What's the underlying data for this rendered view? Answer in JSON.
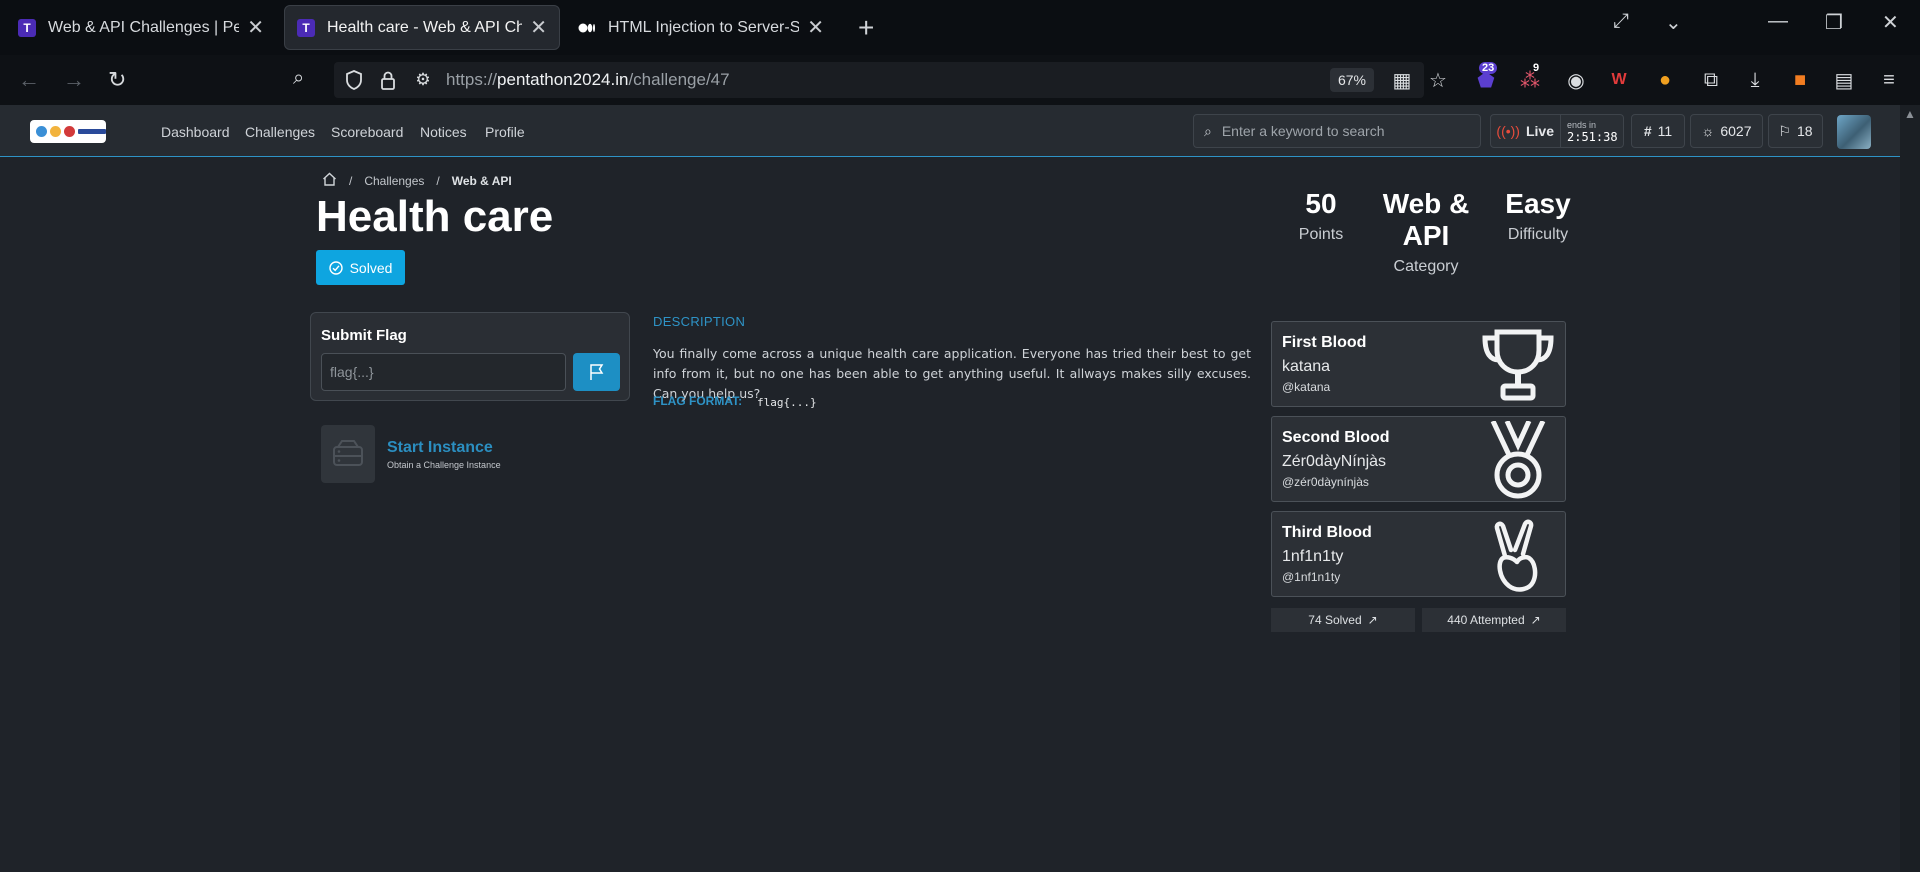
{
  "browser": {
    "tabs": [
      {
        "title": "Web & API Challenges | Pentathon",
        "active": false
      },
      {
        "title": "Health care - Web & API Challenges",
        "active": true
      },
      {
        "title": "HTML Injection to Server-Side Request Forgery",
        "active": false
      }
    ],
    "url_prefix": "https://",
    "url_host": "pentathon2024.in",
    "url_path": "/challenge/47",
    "zoom": "67%",
    "badges": {
      "ext1": "23",
      "ext2": "9"
    }
  },
  "header": {
    "menu": [
      "Dashboard",
      "Challenges",
      "Scoreboard",
      "Notices",
      "Profile"
    ],
    "search_placeholder": "Enter a keyword to search",
    "live_label": "Live",
    "ends_label": "ends in",
    "countdown": "2:51:38",
    "rank": "11",
    "score": "6027",
    "flags": "18"
  },
  "breadcrumb": {
    "level1": "Challenges",
    "level2": "Web & API"
  },
  "challenge": {
    "title": "Health care",
    "status": "Solved",
    "points_value": "50",
    "points_label": "Points",
    "category_value": "Web & API",
    "category_label": "Category",
    "difficulty_value": "Easy",
    "difficulty_label": "Difficulty",
    "description_heading": "DESCRIPTION",
    "description": "You finally come across a unique health care application. Everyone has tried their best to get info from it, but no one has been able to get anything useful. It allways makes silly excuses. Can you help us?",
    "flag_format_label": "FLAG FORMAT:",
    "flag_format": "flag{...}"
  },
  "submit": {
    "heading": "Submit Flag",
    "placeholder": "flag{...}"
  },
  "instance": {
    "title": "Start Instance",
    "subtitle": "Obtain a Challenge Instance"
  },
  "bloods": [
    {
      "title": "First Blood",
      "name": "katana",
      "handle": "@katana",
      "icon": "trophy-icon"
    },
    {
      "title": "Second Blood",
      "name": "Zér0dàyNínjàs",
      "handle": "@zér0dàynínjàs",
      "icon": "medal-icon"
    },
    {
      "title": "Third Blood",
      "name": "1nf1n1ty",
      "handle": "@1nf1n1ty",
      "icon": "peace-hand-icon"
    }
  ],
  "counts": {
    "solved": "74 Solved",
    "attempted": "440 Attempted"
  },
  "colors": {
    "accent": "#2e93c6",
    "solved_button": "#0ea5e0",
    "background": "#1f2329"
  }
}
